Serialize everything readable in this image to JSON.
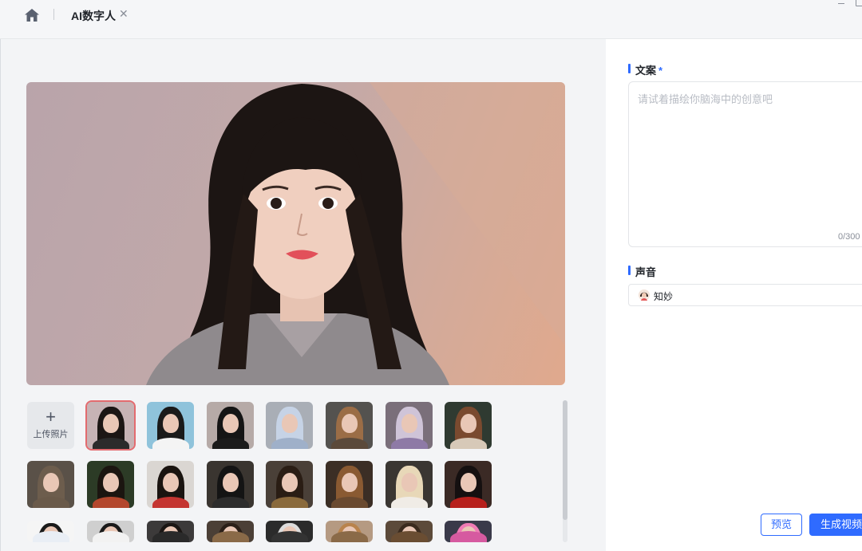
{
  "tab": {
    "title": "AI数字人",
    "close_icon": "close-icon",
    "home_icon": "home-icon"
  },
  "gallery": {
    "upload_label": "上传照片",
    "upload_icon": "plus-icon",
    "selected_index": 0,
    "avatars": [
      {
        "name": "avatar-1",
        "bg": "#c7b3b5",
        "hair": "#1c1614",
        "body": "#2b2b2b"
      },
      {
        "name": "avatar-2",
        "bg": "#8fc3db",
        "hair": "#1a1a1a",
        "body": "#f4f4f4"
      },
      {
        "name": "avatar-3",
        "bg": "#b6aaa7",
        "hair": "#151515",
        "body": "#1b1b1b"
      },
      {
        "name": "avatar-4",
        "bg": "#a9aeb6",
        "hair": "#c6d3e6",
        "body": "#9fb0c9"
      },
      {
        "name": "avatar-5",
        "bg": "#54524f",
        "hair": "#9b6d46",
        "body": "#5b4a3b"
      },
      {
        "name": "avatar-6",
        "bg": "#7a6f7a",
        "hair": "#cfc4d8",
        "body": "#8e7aa6"
      },
      {
        "name": "avatar-7",
        "bg": "#2f3a31",
        "hair": "#7a4a2f",
        "body": "#d7c9b8"
      },
      {
        "name": "avatar-8",
        "bg": "#5a5148",
        "hair": "#6d5d4d",
        "body": "#6a5a4a"
      },
      {
        "name": "avatar-9",
        "bg": "#2c3b26",
        "hair": "#1b1510",
        "body": "#b3472d"
      },
      {
        "name": "avatar-10",
        "bg": "#dad6d2",
        "hair": "#1a1410",
        "body": "#c43531"
      },
      {
        "name": "avatar-11",
        "bg": "#3a3530",
        "hair": "#141414",
        "body": "#2d2d2d"
      },
      {
        "name": "avatar-12",
        "bg": "#4a4038",
        "hair": "#2a1d14",
        "body": "#8a6a3c"
      },
      {
        "name": "avatar-13",
        "bg": "#3b2e25",
        "hair": "#8a5a32",
        "body": "#6a4a30"
      },
      {
        "name": "avatar-14",
        "bg": "#3a3632",
        "hair": "#e8d8b8",
        "body": "#f0ece6"
      },
      {
        "name": "avatar-15",
        "bg": "#3b2a25",
        "hair": "#151010",
        "body": "#b7201c"
      },
      {
        "name": "avatar-16",
        "bg": "#f5f5f5",
        "hair": "#1a1a1a",
        "body": "#e9eef5"
      },
      {
        "name": "avatar-17",
        "bg": "#cfcfcf",
        "hair": "#1a1a1a",
        "body": "#f2f2f2"
      },
      {
        "name": "avatar-18",
        "bg": "#3c3a3a",
        "hair": "#1a1614",
        "body": "#2a2a2a"
      },
      {
        "name": "avatar-19",
        "bg": "#4b3f36",
        "hair": "#2a1f18",
        "body": "#8a6a48"
      },
      {
        "name": "avatar-20",
        "bg": "#2b2b2b",
        "hair": "#dcdcdc",
        "body": "#333"
      },
      {
        "name": "avatar-21",
        "bg": "#b59a82",
        "hair": "#b9834c",
        "body": "#8a6a48"
      },
      {
        "name": "avatar-22",
        "bg": "#5c4a3a",
        "hair": "#3a2a1d",
        "body": "#6a4d32"
      },
      {
        "name": "avatar-23",
        "bg": "#3a3a4a",
        "hair": "#f07bb5",
        "body": "#d65aa0"
      },
      {
        "name": "avatar-24",
        "bg": "#6a5a4a",
        "hair": "#c2542b",
        "body": "#4a7a5a"
      },
      {
        "name": "avatar-25",
        "bg": "#4a3a35",
        "hair": "#3a2418",
        "body": "#7a5a48"
      },
      {
        "name": "avatar-26",
        "bg": "#3a2a25",
        "hair": "#1a1410",
        "body": "#5a3a30"
      }
    ]
  },
  "copy": {
    "label": "文案",
    "required_mark": "*",
    "placeholder": "请试着描绘你脑海中的创意吧",
    "counter": "0/300"
  },
  "voice": {
    "label": "声音",
    "selected": "知妙",
    "avatar_icon": "voice-avatar-icon"
  },
  "actions": {
    "preview_label": "预览",
    "generate_label": "生成视频"
  },
  "colors": {
    "accent": "#2f6bff",
    "selected_outline": "#e36b6f"
  }
}
